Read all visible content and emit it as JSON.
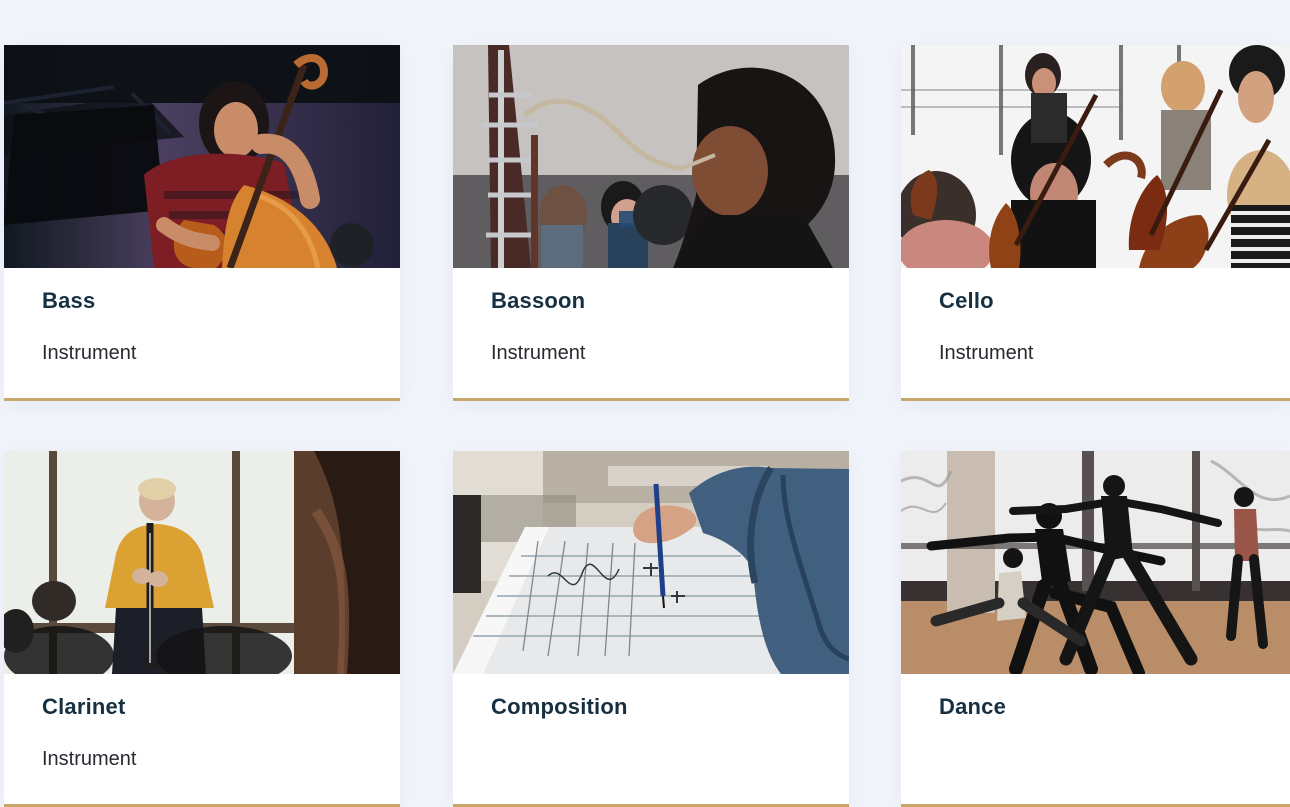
{
  "instruments": [
    {
      "title": "Bass",
      "subtitle": "Instrument",
      "image": "musician playing double bass on outdoor stage"
    },
    {
      "title": "Bassoon",
      "subtitle": "Instrument",
      "image": "student playing bassoon in ensemble"
    },
    {
      "title": "Cello",
      "subtitle": "Instrument",
      "image": "orchestra cello section rehearsing"
    },
    {
      "title": "Clarinet",
      "subtitle": "Instrument",
      "image": "clarinetist performing near large window"
    },
    {
      "title": "Composition",
      "subtitle": "",
      "image": "hand writing on music manuscript paper"
    },
    {
      "title": "Dance",
      "subtitle": "",
      "image": "dancers silhouetted in studio"
    }
  ],
  "colors": {
    "page_background": "#f1f4fb",
    "card_background": "#ffffff",
    "accent_border": "#c8a66a",
    "title_text": "#173041",
    "subtitle_text": "#262b31"
  }
}
